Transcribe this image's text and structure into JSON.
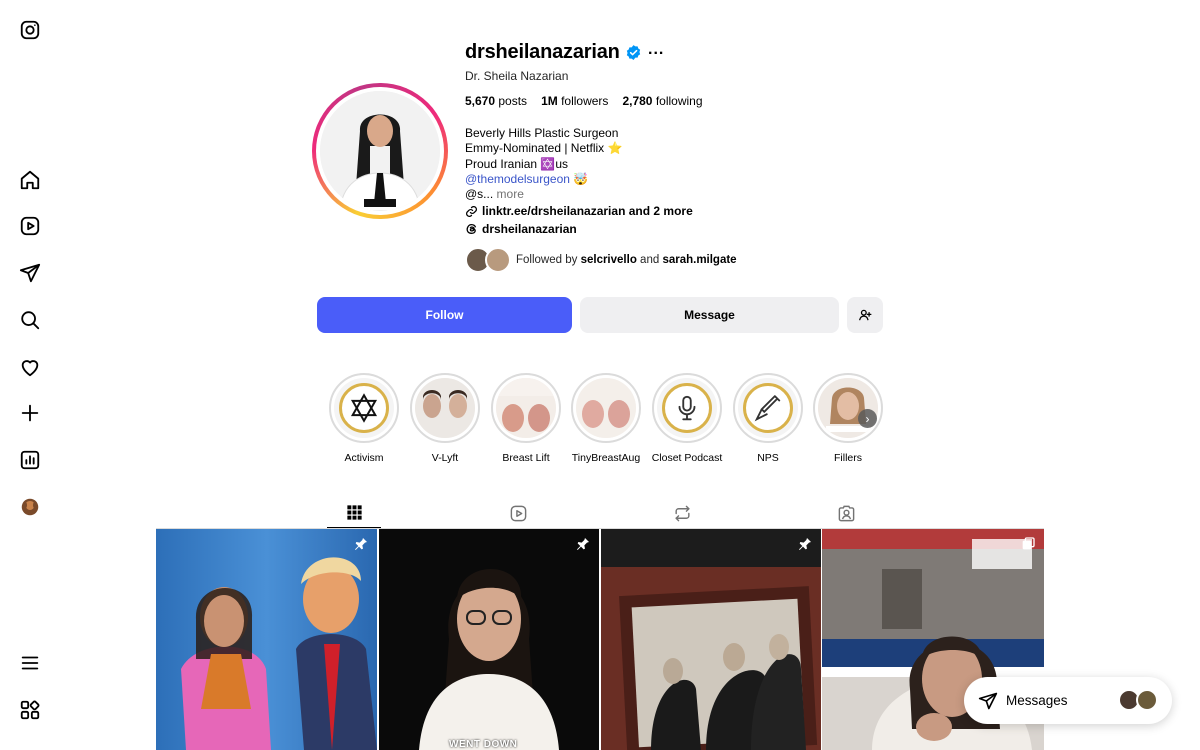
{
  "profile": {
    "username": "drsheilanazarian",
    "full_name": "Dr. Sheila Nazarian",
    "more_icon": "...",
    "stats": {
      "posts": "5,670",
      "posts_label": "posts",
      "followers": "1M",
      "followers_label": "followers",
      "following": "2,780",
      "following_label": "following"
    },
    "bio": {
      "line1": "Beverly Hills Plastic Surgeon",
      "line2": "Emmy-Nominated | Netflix",
      "line2_emoji": "⭐",
      "line3": "Proud Iranian",
      "line3_emoji": "✡️",
      "line3_suffix": "us",
      "mention": "@themodelsurgeon",
      "mention_emoji": "🤯",
      "truncated": "@s...",
      "more": "more"
    },
    "link": "linktr.ee/drsheilanazarian and 2 more",
    "threads": "drsheilanazarian",
    "followed_by": {
      "prefix": "Followed by",
      "user1": "selcrivello",
      "and": "and",
      "user2": "sarah.milgate"
    }
  },
  "buttons": {
    "follow": "Follow",
    "message": "Message"
  },
  "highlights": [
    {
      "label": "Activism"
    },
    {
      "label": "V-Lyft"
    },
    {
      "label": "Breast Lift"
    },
    {
      "label": "TinyBreastAug"
    },
    {
      "label": "Closet Podcast"
    },
    {
      "label": "NPS"
    },
    {
      "label": "Fillers"
    }
  ],
  "posts": {
    "caption2": "WENT DOWN"
  },
  "messages": {
    "label": "Messages"
  },
  "colors": {
    "follow_blue": "#4a5df9",
    "verified_blue": "#0095f6",
    "mention": "#3a55c9"
  }
}
